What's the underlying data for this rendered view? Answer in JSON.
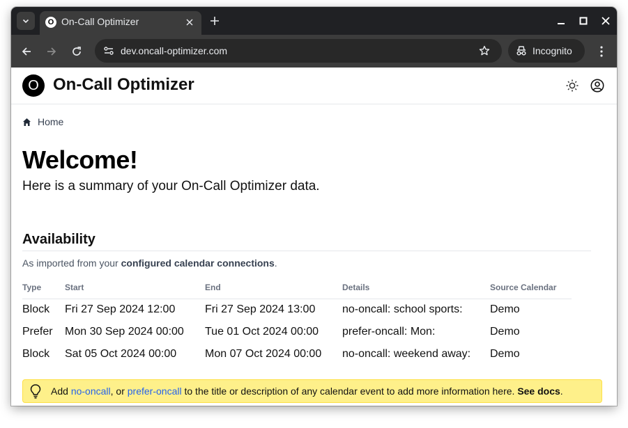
{
  "browser": {
    "tab_title": "On-Call Optimizer",
    "tab_favicon_text": "O",
    "url": "dev.oncall-optimizer.com",
    "incognito_label": "Incognito"
  },
  "app": {
    "logo_text": "O",
    "title": "On-Call Optimizer"
  },
  "breadcrumb": {
    "home": "Home"
  },
  "main": {
    "heading": "Welcome!",
    "subtitle": "Here is a summary of your On-Call Optimizer data."
  },
  "availability": {
    "title": "Availability",
    "desc_prefix": "As imported from your ",
    "desc_link": "configured calendar connections",
    "desc_suffix": ".",
    "columns": [
      "Type",
      "Start",
      "End",
      "Details",
      "Source Calendar"
    ],
    "rows": [
      [
        "Block",
        "Fri 27 Sep 2024 12:00",
        "Fri 27 Sep 2024 13:00",
        "no-oncall: school sports:",
        "Demo"
      ],
      [
        "Prefer",
        "Mon 30 Sep 2024 00:00",
        "Tue 01 Oct 2024 00:00",
        "prefer-oncall: Mon:",
        "Demo"
      ],
      [
        "Block",
        "Sat 05 Oct 2024 00:00",
        "Mon 07 Oct 2024 00:00",
        "no-oncall: weekend away:",
        "Demo"
      ]
    ]
  },
  "alert": {
    "text_1": "Add ",
    "link_1": "no-oncall",
    "text_2": ", or ",
    "link_2": "prefer-oncall",
    "text_3": " to the title or description of any calendar event to add more information here. ",
    "docs_link": "See docs",
    "text_4": "."
  },
  "colors": {
    "alert_bg": "#fef08a",
    "link": "#2563eb",
    "chrome_dark": "#202124"
  }
}
